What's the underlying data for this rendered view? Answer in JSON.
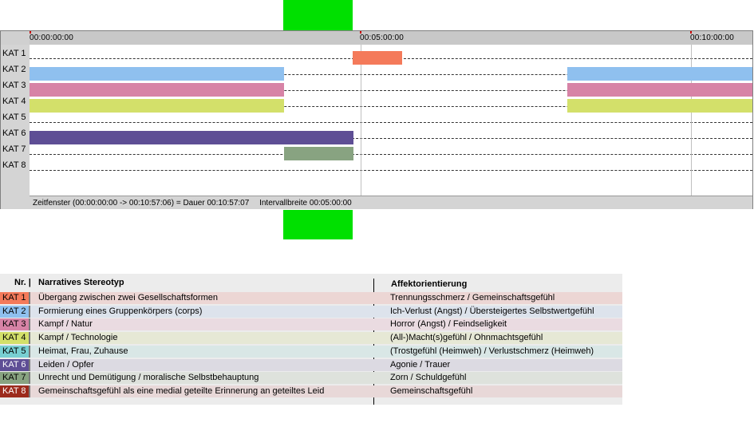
{
  "ruler": {
    "ticks": [
      "00:00:00:00",
      "00:05:00:00",
      "00:10:00:00"
    ]
  },
  "categories": [
    "KAT 1",
    "KAT 2",
    "KAT 3",
    "KAT 4",
    "KAT 5",
    "KAT 6",
    "KAT 7",
    "KAT 8"
  ],
  "colors": {
    "kat1": "#f47a5a",
    "kat2": "#8fc0ef",
    "kat3": "#d783a6",
    "kat4": "#d3e06a",
    "kat5": "#78cfd2",
    "kat6": "#5e4e95",
    "kat7": "#88a381",
    "kat8": "#9c2a1c",
    "highlight": "#00e000"
  },
  "status": {
    "window": "Zeitfenster (00:00:00:00 -> 00:10:57:06) = Dauer 00:10:57:07",
    "interval": "Intervallbreite 00:05:00:00"
  },
  "legend": {
    "col_nr": "Nr. |",
    "col_stereotype": "Narratives Stereotyp",
    "col_affect": "Affektorientierung",
    "rows": [
      {
        "nr": "KAT 1",
        "stereotype": "Übergang zwischen zwei Gesellschaftsformen",
        "affect": "Trennungsschmerz / Gemeinschaftsgefühl",
        "bg": "#f47a5a",
        "fg": "#000",
        "rowbg": "#ecd6d4"
      },
      {
        "nr": "KAT 2",
        "stereotype": "Formierung eines Gruppenkörpers (corps)",
        "affect": "Ich-Verlust (Angst) / Übersteigertes Selbstwertgefühl",
        "bg": "#8fc0ef",
        "fg": "#000",
        "rowbg": "#dde3ec"
      },
      {
        "nr": "KAT 3",
        "stereotype": "Kampf / Natur",
        "affect": "Horror (Angst) / Feindseligkeit",
        "bg": "#d783a6",
        "fg": "#000",
        "rowbg": "#eadbe1"
      },
      {
        "nr": "KAT 4",
        "stereotype": "Kampf / Technologie",
        "affect": "(All-)Macht(s)gefühl / Ohnmachtsgefühl",
        "bg": "#d3e06a",
        "fg": "#000",
        "rowbg": "#e6e8d5"
      },
      {
        "nr": "KAT 5",
        "stereotype": "Heimat, Frau, Zuhause",
        "affect": "(Trostgefühl (Heimweh) / Verlustschmerz (Heimweh)",
        "bg": "#78cfd2",
        "fg": "#000",
        "rowbg": "#d9e7e6"
      },
      {
        "nr": "KAT 6",
        "stereotype": "Leiden / Opfer",
        "affect": "Agonie / Trauer",
        "bg": "#5e4e95",
        "fg": "#fff",
        "rowbg": "#dcdae2"
      },
      {
        "nr": "KAT 7",
        "stereotype": "Unrecht und Demütigung / moralische Selbstbehauptung",
        "affect": "Zorn / Schuldgefühl",
        "bg": "#88a381",
        "fg": "#000",
        "rowbg": "#dee2dc"
      },
      {
        "nr": "KAT 8",
        "stereotype": "Gemeinschaftsgefühl als eine medial geteilte Erinnerung an geteiltes Leid",
        "affect": "Gemeinschaftsgefühl",
        "bg": "#9c2a1c",
        "fg": "#fff",
        "rowbg": "#e8d8d8"
      }
    ]
  }
}
